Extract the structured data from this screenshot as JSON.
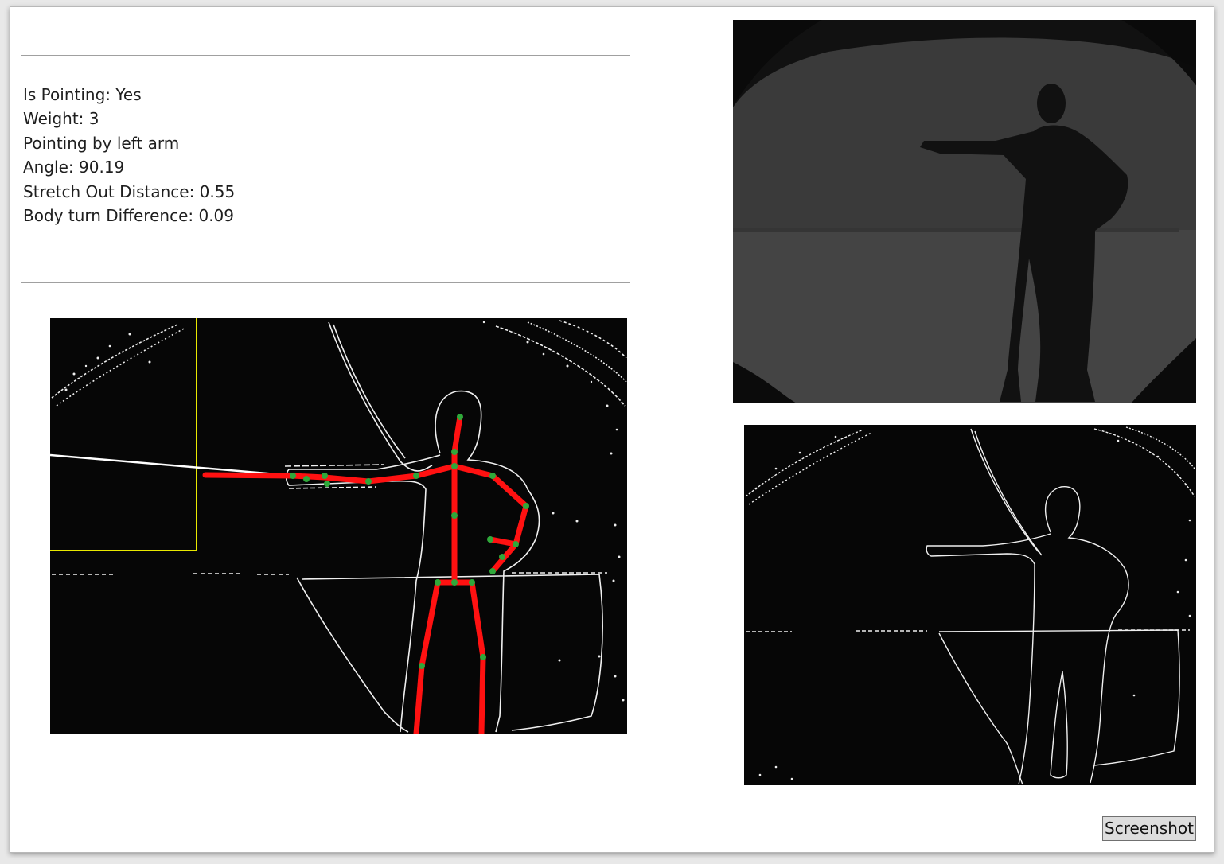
{
  "info": {
    "lines": [
      "Is Pointing: Yes",
      "Weight: 3",
      "Pointing by left arm",
      "Angle: 90.19",
      "Stretch Out Distance: 0.55",
      "Body turn Difference: 0.09"
    ]
  },
  "buttons": {
    "screenshot_label": "Screenshot"
  },
  "colors": {
    "skeleton_bone": "#ff1111",
    "skeleton_joint": "#2fa83a",
    "pointing_ray": "#ffffff",
    "target_box": "#e8e800",
    "edge_lines": "#f0f0f0"
  }
}
